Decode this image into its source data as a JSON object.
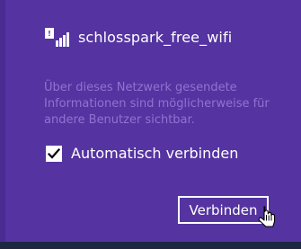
{
  "network": {
    "name": "schlosspark_free_wifi",
    "icon": "wifi-security-warning-icon"
  },
  "warning": {
    "text": "Über dieses Netzwerk gesendete Informationen sind möglicherweise für andere Benutzer sichtbar."
  },
  "options": {
    "auto_connect_label": "Automatisch verbinden",
    "auto_connect_checked": true
  },
  "actions": {
    "connect_label": "Verbinden"
  },
  "colors": {
    "panel": "#5533a1",
    "text_primary": "#ffffff",
    "text_secondary": "#8f74cf",
    "taskbar": "#1c2742"
  },
  "cursor": {
    "icon": "pointer-hand-cursor-icon"
  }
}
